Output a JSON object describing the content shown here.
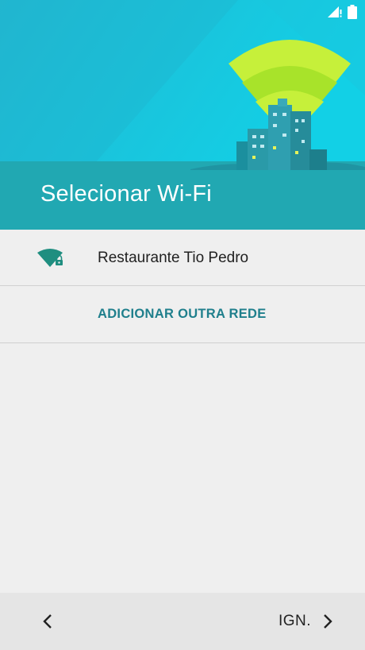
{
  "header": {
    "title": "Selecionar Wi-Fi",
    "accent_color": "#21b0bf"
  },
  "status_bar": {
    "icons": [
      "signal-no-sim-icon",
      "battery-full-icon"
    ]
  },
  "networks": [
    {
      "ssid": "Restaurante Tio Pedro",
      "secured": true,
      "icon": "wifi-locked-icon"
    }
  ],
  "add_network": {
    "label": "ADICIONAR OUTRA REDE",
    "color": "#1f7f8c"
  },
  "navigation": {
    "back_icon": "chevron-left-icon",
    "skip_label": "IGN.",
    "skip_icon": "chevron-right-icon"
  }
}
